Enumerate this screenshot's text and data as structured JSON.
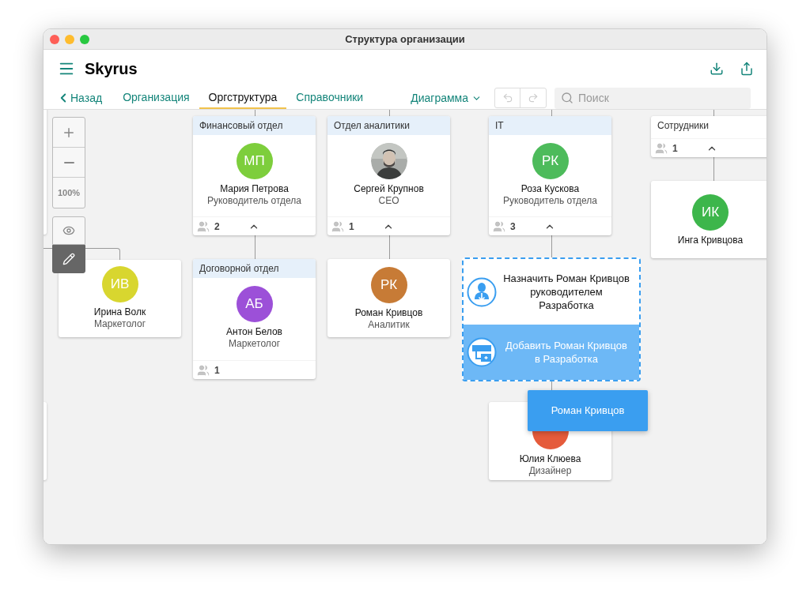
{
  "window": {
    "title": "Структура организации"
  },
  "header": {
    "brand": "Skyrus"
  },
  "nav": {
    "back": "Назад",
    "tabs": [
      {
        "label": "Организация",
        "selected": false
      },
      {
        "label": "Оргструктура",
        "selected": true
      },
      {
        "label": "Справочники",
        "selected": false
      }
    ],
    "view": "Диаграмма",
    "undo_disabled": true,
    "redo_disabled": true,
    "search": {
      "placeholder": "Поиск"
    }
  },
  "zoom_controls": {
    "zoom": "100%"
  },
  "view_tools": [
    {
      "kind": "view",
      "selected": false
    },
    {
      "kind": "edit",
      "selected": true
    }
  ],
  "nodes": [
    {
      "kind": "department",
      "title": "Финансовый отдел",
      "avatar": {
        "kind": "initials",
        "initials": "МП",
        "color": "#7dce3c"
      },
      "name": "Мария Петрова",
      "role": "Руководитель отдела",
      "count": "2",
      "has_children": true
    },
    {
      "kind": "department",
      "title": "Отдел аналитики",
      "name": "Сергей Крупнов",
      "role": "CEO",
      "count": "1",
      "has_children": true
    },
    {
      "kind": "department",
      "title": "IT",
      "avatar": {
        "kind": "initials",
        "initials": "РК",
        "color": "#4dbb5b"
      },
      "name": "Роза Кускова",
      "role": "Руководитель отдела",
      "count": "3",
      "has_children": true
    },
    {
      "kind": "group",
      "title": "Сотрудники",
      "count": "1",
      "has_children": true
    },
    {
      "kind": "person",
      "avatar": {
        "kind": "initials",
        "initials": "ИК",
        "color": "#3db64b"
      },
      "name": "Инга Кривцова"
    },
    {
      "kind": "person",
      "avatar": {
        "kind": "initials",
        "initials": "ИВ",
        "color": "#d8d62f"
      },
      "name": "Ирина Волк",
      "role": "Маркетолог"
    },
    {
      "kind": "department",
      "title": "Договорной отдел",
      "avatar": {
        "kind": "initials",
        "initials": "АБ",
        "color": "#9c50d8"
      },
      "name": "Антон Белов",
      "role": "Маркетолог",
      "count": "1",
      "has_children": false
    },
    {
      "kind": "person",
      "avatar": {
        "kind": "initials",
        "initials": "РК",
        "color": "#c77b36"
      },
      "name": "Роман Кривцов",
      "role": "Аналитик"
    },
    {
      "kind": "person",
      "avatar": {
        "kind": "blank",
        "color": "#e55b3b"
      },
      "name": "Юлия Клюева",
      "role": "Дизайнер"
    }
  ],
  "drop_menu": [
    {
      "kind": "assign",
      "text": "Назначить Роман Кривцов руководителем Разработка",
      "selected": false
    },
    {
      "kind": "add",
      "text": "Добавить Роман Кривцов в Разработка",
      "selected": true
    }
  ],
  "drag_tile": "Роман Кривцов"
}
